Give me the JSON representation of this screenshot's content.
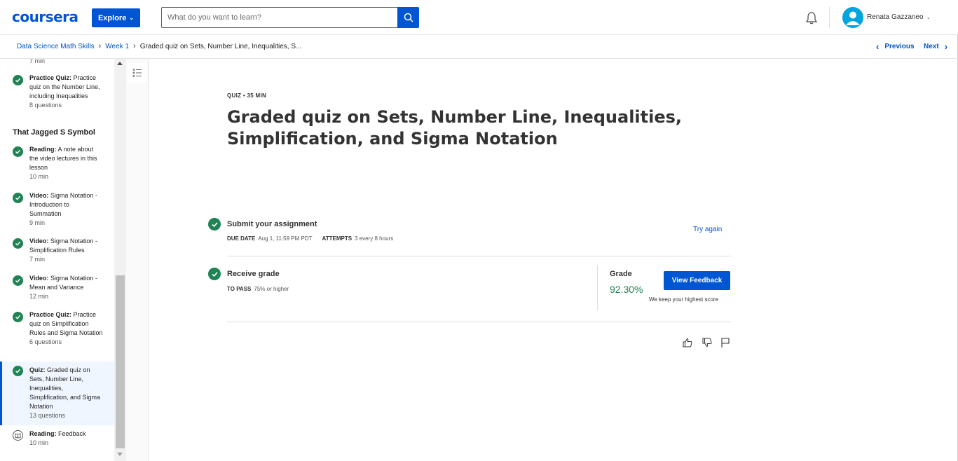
{
  "header": {
    "logo": "coursera",
    "explore_label": "Explore",
    "search_placeholder": "What do you want to learn?",
    "user_name": "Renata Gazzaneo"
  },
  "breadcrumb": {
    "items": [
      "Data Science Math Skills",
      "Week 1",
      "Graded quiz on Sets, Number Line, Inequalities, S..."
    ],
    "prev_label": "Previous",
    "next_label": "Next"
  },
  "sidebar": {
    "top_meta": "7 min",
    "items": [
      {
        "kind": "Practice Quiz:",
        "name": "Practice quiz on the Number Line, including Inequalities",
        "meta": "8 questions",
        "status": "complete"
      },
      {
        "kind": "Reading:",
        "name": "A note about the video lectures in this lesson",
        "meta": "10 min",
        "status": "complete"
      },
      {
        "kind": "Video:",
        "name": "Sigma Notation - Introduction to Summation",
        "meta": "9 min",
        "status": "complete"
      },
      {
        "kind": "Video:",
        "name": "Sigma Notation - Simplification Rules",
        "meta": "7 min",
        "status": "complete"
      },
      {
        "kind": "Video:",
        "name": "Sigma Notation - Mean and Variance",
        "meta": "12 min",
        "status": "complete"
      },
      {
        "kind": "Practice Quiz:",
        "name": "Practice quiz on Simplification Rules and Sigma Notation",
        "meta": "6 questions",
        "status": "complete"
      },
      {
        "kind": "Quiz:",
        "name": "Graded quiz on Sets, Number Line, Inequalities, Simplification, and Sigma Notation",
        "meta": "13 questions",
        "status": "complete",
        "active": true
      },
      {
        "kind": "Reading:",
        "name": "Feedback",
        "meta": "10 min",
        "status": "not-started"
      }
    ],
    "section_title": "That Jagged S Symbol"
  },
  "main": {
    "kicker": "QUIZ • 35 MIN",
    "title": "Graded quiz on Sets, Number Line, Inequalities, Simplification, and Sigma Notation",
    "submit": {
      "title": "Submit your assignment",
      "due_label": "DUE DATE",
      "due_value": "Aug 1, 11:59 PM PDT",
      "attempts_label": "ATTEMPTS",
      "attempts_value": "3 every 8 hours",
      "try_again": "Try again"
    },
    "receive": {
      "title": "Receive grade",
      "pass_label": "TO PASS",
      "pass_value": "75% or higher",
      "grade_label": "Grade",
      "grade_value": "92.30%",
      "view_feedback": "View Feedback",
      "keep_note": "We keep your highest score"
    }
  },
  "colors": {
    "brand": "#0056d2",
    "success": "#1f8354"
  }
}
